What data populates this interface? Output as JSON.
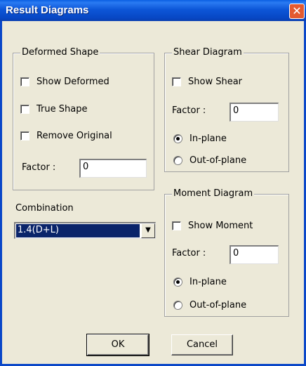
{
  "window": {
    "title": "Result Diagrams",
    "close_icon": "✕"
  },
  "deformed": {
    "legend": "Deformed Shape",
    "show_deformed": "Show Deformed",
    "true_shape": "True Shape",
    "remove_original": "Remove Original",
    "factor_label": "Factor :",
    "factor_value": "0"
  },
  "combination": {
    "label": "Combination",
    "selected": "1.4(D+L)",
    "arrow": "▼"
  },
  "shear": {
    "legend": "Shear Diagram",
    "show_shear": "Show Shear",
    "factor_label": "Factor :",
    "factor_value": "0",
    "in_plane": "In-plane",
    "out_of_plane": "Out-of-plane"
  },
  "moment": {
    "legend": "Moment Diagram",
    "show_moment": "Show Moment",
    "factor_label": "Factor :",
    "factor_value": "0",
    "in_plane": "In-plane",
    "out_of_plane": "Out-of-plane"
  },
  "buttons": {
    "ok": "OK",
    "cancel": "Cancel"
  }
}
